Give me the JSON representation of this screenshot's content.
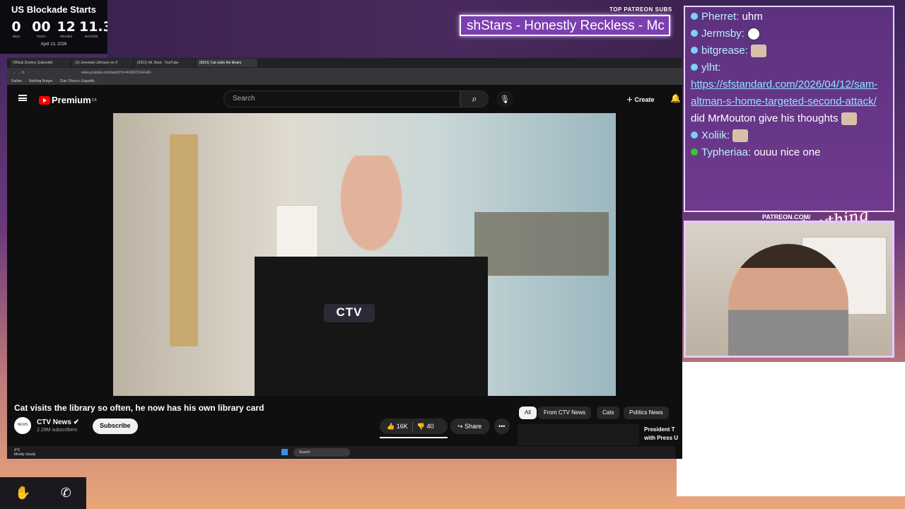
{
  "countdown": {
    "title": "US Blockade Starts",
    "values": [
      "0",
      "00",
      "12",
      "11.3"
    ],
    "units": [
      "days",
      "hours",
      "minutes",
      "seconds"
    ],
    "date": "April 13, 2026"
  },
  "patreon": {
    "label": "TOP PATREON SUBS",
    "ticker": "shStars - Honestly Reckless - Mc"
  },
  "chat": {
    "messages": [
      {
        "user": "Pherret:",
        "text": " uhm"
      },
      {
        "user": "Jermsby:",
        "text": ""
      },
      {
        "user": "bitgrease:",
        "text": ""
      },
      {
        "user": "ylht:",
        "text": ""
      },
      {
        "user": "Xoliik:",
        "text": ""
      },
      {
        "user": "Typheriaa:",
        "text": " ouuu nice one"
      }
    ],
    "link": "https://sfstandard.com/2026/04/12/sam-altman-s-home-targeted-second-attack/",
    "link_suffix": " did MrMouton give his thoughts"
  },
  "webcam": {
    "patreon_url": "PATREON.COM/",
    "brand": "Anything Else"
  },
  "browser": {
    "tabs": [
      "Official Destiny Subreddit",
      "(X) Jeremiah Johnson on X",
      "(6521) Mr. Beat - YouTube",
      "(6521) Cat visits the library"
    ],
    "url": "www.youtube.com/watch?v=AX(hFOUeFe8s",
    "bookmarks": [
      "Dailies",
      "Nothing Burger",
      "Clair Obscur: Expediti..."
    ]
  },
  "youtube": {
    "logo": "Premium",
    "region": "CA",
    "search_placeholder": "Search",
    "create_label": "Create",
    "video_overlay": "CTV",
    "video_title": "Cat visits the library so often, he now has his own library card",
    "channel_name": "CTV News",
    "channel_avatar": "NEWS",
    "subscribers": "2.29M subscribers",
    "subscribe_label": "Subscribe",
    "likes": "16K",
    "dislikes": "40",
    "share_label": "Share",
    "chips": [
      "All",
      "From CTV News",
      "Cats",
      "Politics News"
    ],
    "side_title_1": "President T",
    "side_title_2": "with Press U"
  },
  "taskbar": {
    "weather_temp": "4°C",
    "weather_desc": "Mostly cloudy",
    "search": "Search"
  }
}
